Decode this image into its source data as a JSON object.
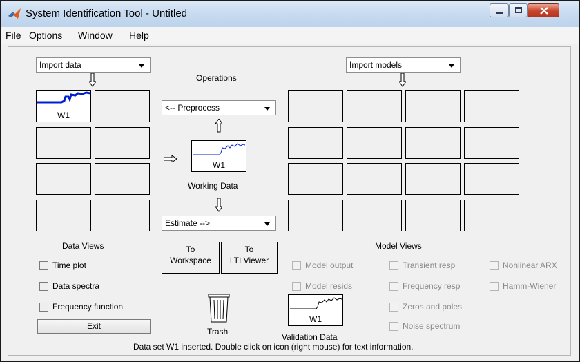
{
  "window": {
    "title": "System Identification Tool - Untitled"
  },
  "menu": [
    "File",
    "Options",
    "Window",
    "Help"
  ],
  "import_data": {
    "label": "Import data"
  },
  "import_models": {
    "label": "Import models"
  },
  "operations": {
    "heading": "Operations",
    "preprocess": "<-- Preprocess",
    "estimate": "Estimate -->",
    "working_data_label": "Working Data",
    "working_data_icon": "W1"
  },
  "data_views": {
    "heading": "Data Views",
    "first_icon_label": "W1",
    "checkboxes": [
      "Time plot",
      "Data spectra",
      "Frequency function"
    ],
    "exit": "Exit"
  },
  "to_workspace": {
    "line1": "To",
    "line2": "Workspace"
  },
  "to_lti": {
    "line1": "To",
    "line2": "LTI Viewer"
  },
  "trash": {
    "label": "Trash"
  },
  "validation": {
    "icon_label": "W1",
    "label": "Validation Data"
  },
  "model_views": {
    "heading": "Model Views",
    "checks_col1": [
      "Model output",
      "Model resids"
    ],
    "checks_col2": [
      "Transient resp",
      "Frequency resp",
      "Zeros and poles",
      "Noise spectrum"
    ],
    "checks_col3": [
      "Nonlinear ARX",
      "Hamm-Wiener"
    ]
  },
  "status": "Data set W1 inserted.  Double click on icon (right mouse) for text information.",
  "colors": {
    "plot_line": "#0020d0",
    "window_border": "#1a1a1a"
  }
}
